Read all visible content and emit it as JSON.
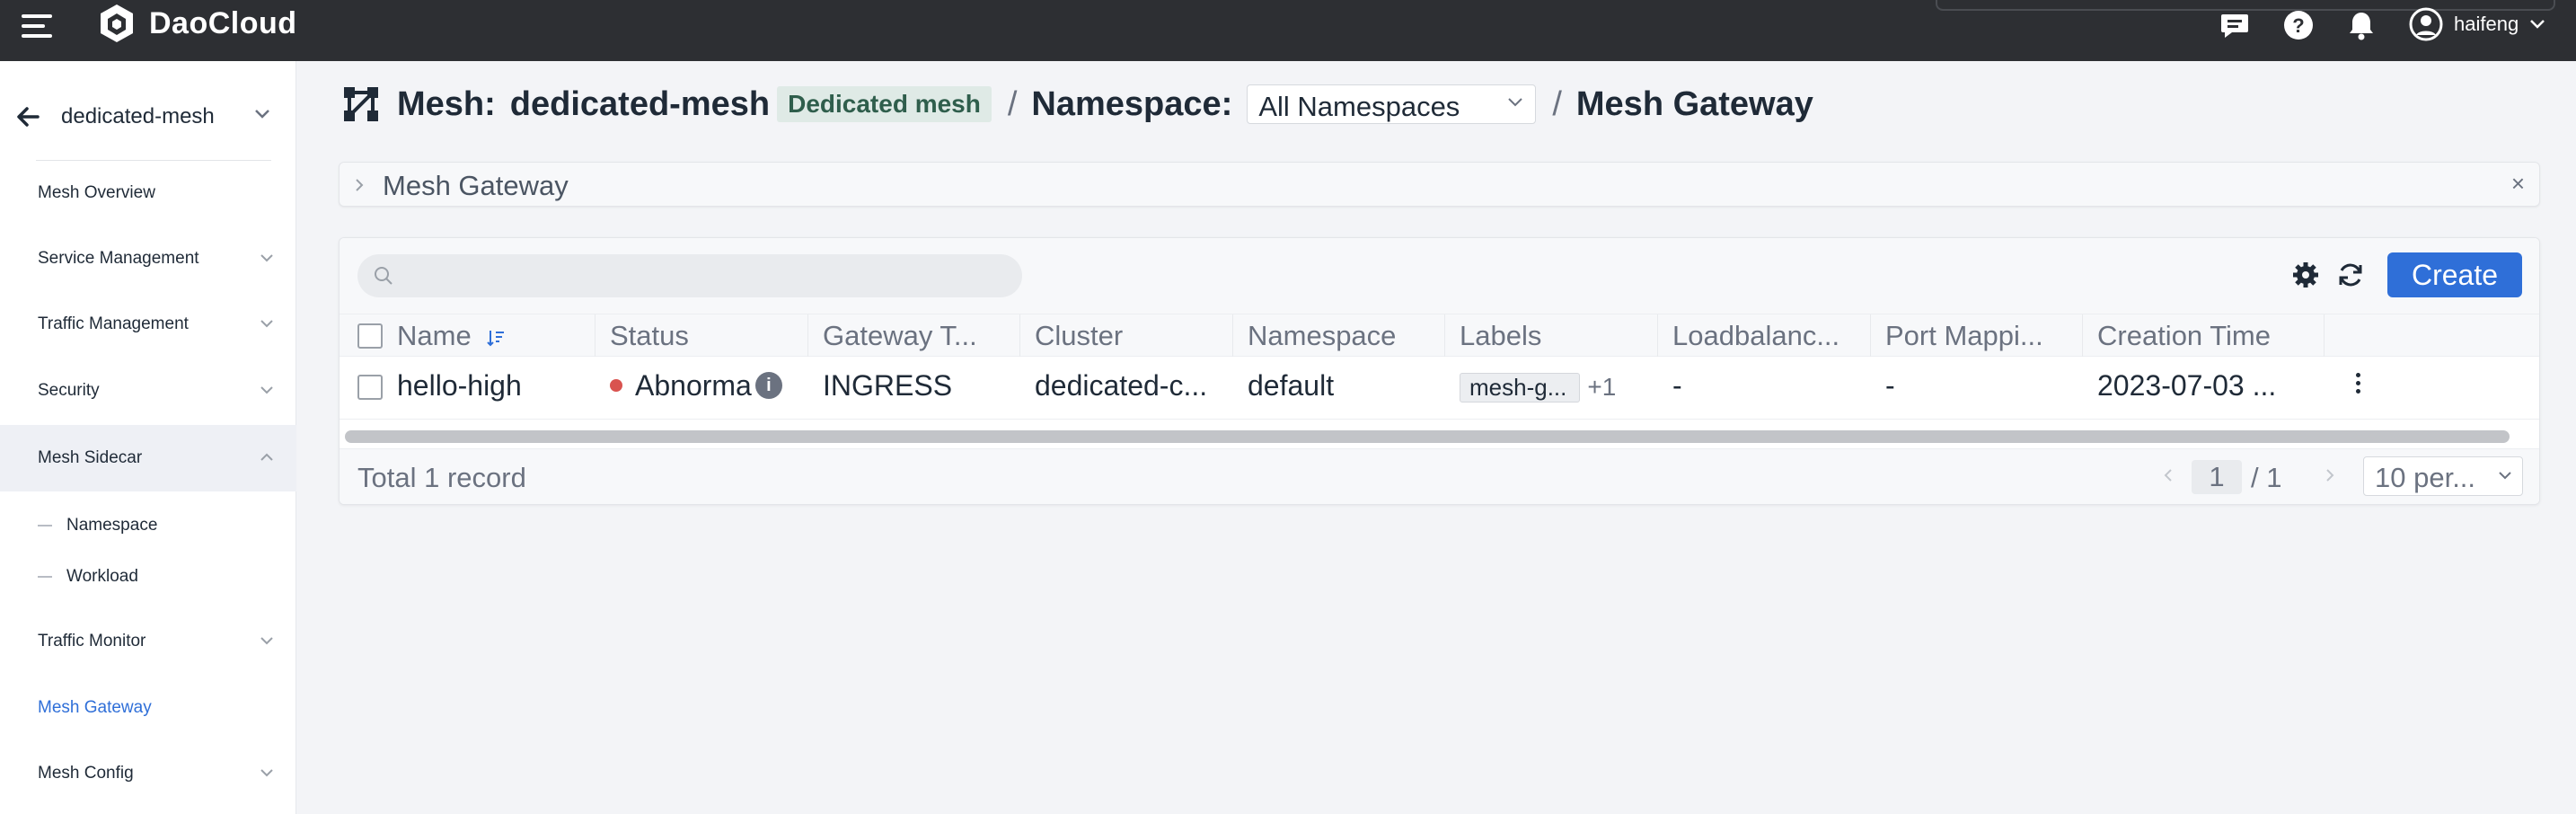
{
  "app": {
    "logo_text": "DaoCloud",
    "user_name": "haifeng"
  },
  "sidebar": {
    "mesh_name": "dedicated-mesh",
    "items": [
      {
        "label": "Mesh Overview"
      },
      {
        "label": "Service Management"
      },
      {
        "label": "Traffic Management"
      },
      {
        "label": "Security"
      },
      {
        "label": "Mesh Sidecar"
      },
      {
        "label": "Namespace"
      },
      {
        "label": "Workload"
      },
      {
        "label": "Traffic Monitor"
      },
      {
        "label": "Mesh Gateway"
      },
      {
        "label": "Mesh Config"
      }
    ]
  },
  "breadcrumb": {
    "mesh_prefix": "Mesh:",
    "mesh_name": "dedicated-mesh",
    "mesh_badge": "Dedicated mesh",
    "sep": "/",
    "namespace_prefix": "Namespace:",
    "namespace_value": "All Namespaces",
    "page": "Mesh Gateway"
  },
  "panel": {
    "title": "Mesh Gateway",
    "close": "×"
  },
  "toolbar": {
    "search_placeholder": "",
    "create_label": "Create"
  },
  "table": {
    "columns": [
      "Name",
      "Status",
      "Gateway T...",
      "Cluster",
      "Namespace",
      "Labels",
      "Loadbalanc...",
      "Port Mappi...",
      "Creation Time"
    ],
    "rows": [
      {
        "name": "hello-high",
        "status": "Abnorma",
        "gateway_type": "INGRESS",
        "cluster": "dedicated-c...",
        "namespace": "default",
        "label_tag": "mesh-g...",
        "label_more": "+1",
        "loadbalancer": "-",
        "port_mapping": "-",
        "creation_time": "2023-07-03 ..."
      }
    ]
  },
  "footer": {
    "total": "Total 1 record",
    "current_page": "1",
    "total_pages": "/ 1",
    "per_page": "10 per..."
  },
  "colors": {
    "accent": "#2f6fd8",
    "topbar": "#2d2f33",
    "error": "#d9534f",
    "badge_bg": "#dfeae6"
  }
}
